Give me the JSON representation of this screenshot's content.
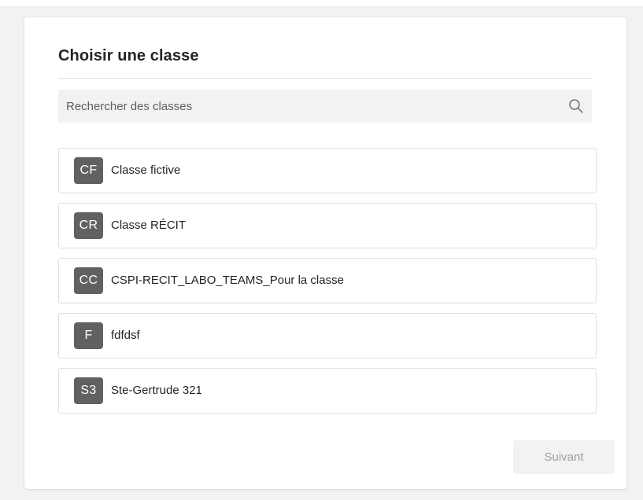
{
  "dialog": {
    "title": "Choisir une classe"
  },
  "search": {
    "placeholder": "Rechercher des classes",
    "value": "",
    "icon": "search-icon"
  },
  "classes": [
    {
      "initials": "CF",
      "name": "Classe fictive"
    },
    {
      "initials": "CR",
      "name": "Classe RÉCIT"
    },
    {
      "initials": "CC",
      "name": "CSPI-RECIT_LABO_TEAMS_Pour la classe"
    },
    {
      "initials": "F",
      "name": "fdfdsf"
    },
    {
      "initials": "S3",
      "name": "Ste-Gertrude 321"
    }
  ],
  "actions": {
    "next_label": "Suivant"
  },
  "colors": {
    "avatar_bg": "#616161",
    "background": "#f3f2f1",
    "card": "#ffffff",
    "disabled_text": "#a19f9d"
  }
}
